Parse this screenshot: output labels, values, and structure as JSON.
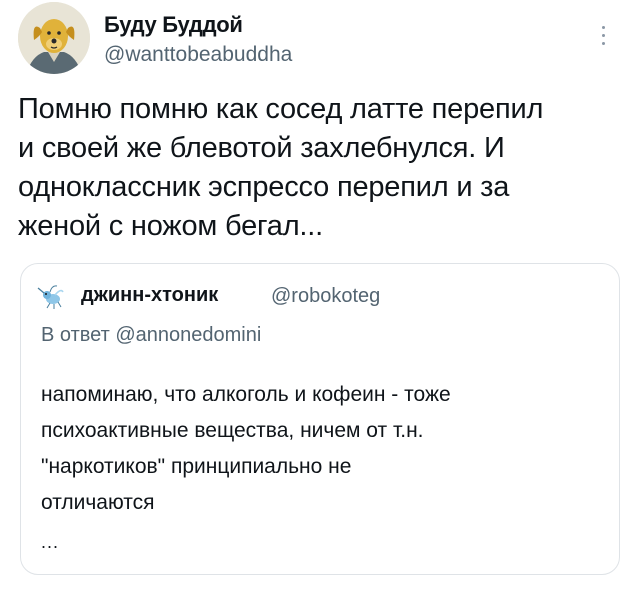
{
  "author": {
    "display_name": "Буду Буддой",
    "handle": "@wanttobeabuddha",
    "avatar_icon": "cartoon-dog-avatar"
  },
  "tweet": {
    "text_lines": [
      "Помню помню как сосед латте перепил",
      "и своей же блевотой захлебнулся. И",
      "одноклассник эспрессо перепил и за",
      "женой с ножом бегал..."
    ]
  },
  "quote": {
    "display_name": "джинн-хтоник",
    "handle": "@robokoteg",
    "reply_prefix": "В ответ",
    "reply_to": "@annonedomini",
    "avatar_icon": "mosquito-avatar",
    "text_lines": [
      "напоминаю, что алкоголь и кофеин - тоже",
      "психоактивные вещества, ничем от т.н.",
      "\"наркотиков\" принципиально не",
      "отличаются"
    ],
    "ellipsis": "..."
  },
  "colors": {
    "text": "#0f1419",
    "secondary": "#536471",
    "border": "#dfe3e7"
  },
  "more_icon": "more-vertical-icon"
}
